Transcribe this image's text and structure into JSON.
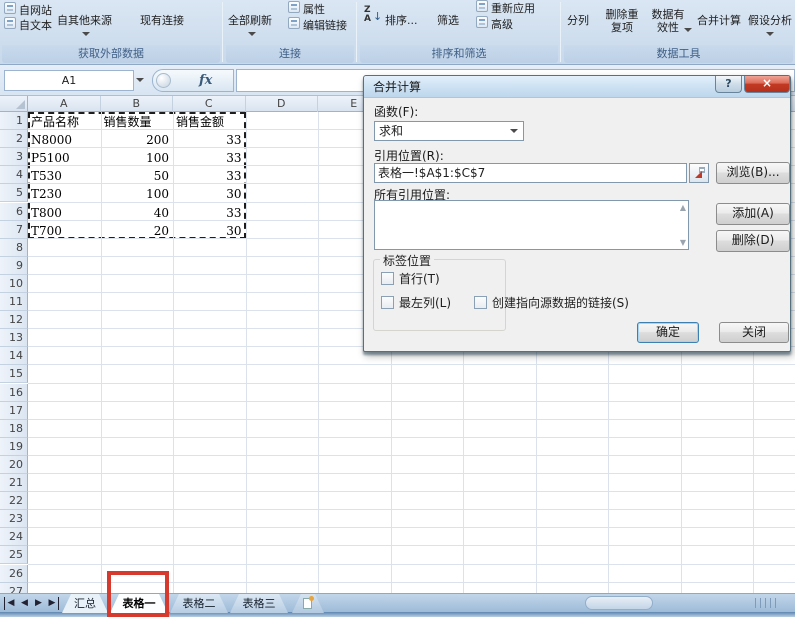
{
  "ribbon": {
    "items": {
      "from_web": "自网站",
      "from_text": "自文本",
      "from_other_sources": "自其他来源",
      "existing_connections": "现有连接",
      "refresh_all": "全部刷新",
      "properties": "属性",
      "edit_links": "编辑链接",
      "sort": "排序...",
      "filter": "筛选",
      "reapply": "重新应用",
      "advanced": "高级",
      "text_to_columns": "分列",
      "remove_duplicates": "删除重复项",
      "data_validation": "数据有效性",
      "consolidate": "合并计算",
      "what_if_analysis": "假设分析"
    },
    "group_labels": [
      "获取外部数据",
      "连接",
      "排序和筛选",
      "数据工具"
    ]
  },
  "formula_bar": {
    "name_box": "A1",
    "fx_label": "fx",
    "formula_value": ""
  },
  "sheet": {
    "columns": [
      "A",
      "B",
      "C",
      "D",
      "E"
    ],
    "row_count": 27,
    "selection": "A1:C7",
    "table": {
      "headers": [
        "产品名称",
        "销售数量",
        "销售金额"
      ],
      "rows": [
        [
          "N8000",
          "200",
          "33"
        ],
        [
          "P5100",
          "100",
          "33"
        ],
        [
          "T530",
          "50",
          "33"
        ],
        [
          "T230",
          "100",
          "30"
        ],
        [
          "T800",
          "40",
          "33"
        ],
        [
          "T700",
          "20",
          "30"
        ]
      ]
    }
  },
  "dialog": {
    "title": "合并计算",
    "function_label": "函数(F):",
    "function_value": "求和",
    "reference_label": "引用位置(R):",
    "reference_value": "表格一!$A$1:$C$7",
    "browse_button": "浏览(B)...",
    "all_references_label": "所有引用位置:",
    "add_button": "添加(A)",
    "delete_button": "删除(D)",
    "label_position_group": "标签位置",
    "top_row_checkbox": "首行(T)",
    "left_column_checkbox": "最左列(L)",
    "create_link_checkbox": "创建指向源数据的链接(S)",
    "ok_button": "确定",
    "close_button": "关闭"
  },
  "tab_bar": {
    "tabs": [
      {
        "label": "汇总",
        "state": "light"
      },
      {
        "label": "表格一",
        "state": "active"
      },
      {
        "label": "表格二",
        "state": "inactive"
      },
      {
        "label": "表格三",
        "state": "inactive"
      }
    ]
  },
  "icons": {
    "help": "?",
    "close": "×",
    "dropdown_arrow": "▼",
    "sort_za": "ZA",
    "sort_down_arrow": "↓",
    "scroll_up": "▲",
    "scroll_down": "▼",
    "nav_first": "◀",
    "nav_prev": "◀",
    "nav_next": "▶",
    "nav_last": "▶"
  },
  "colors": {
    "annotation_red": "#d6392e",
    "close_button_red": "#c23a24",
    "ribbon_blue": "#cfdeee",
    "group_label_text": "#3f5f87"
  }
}
